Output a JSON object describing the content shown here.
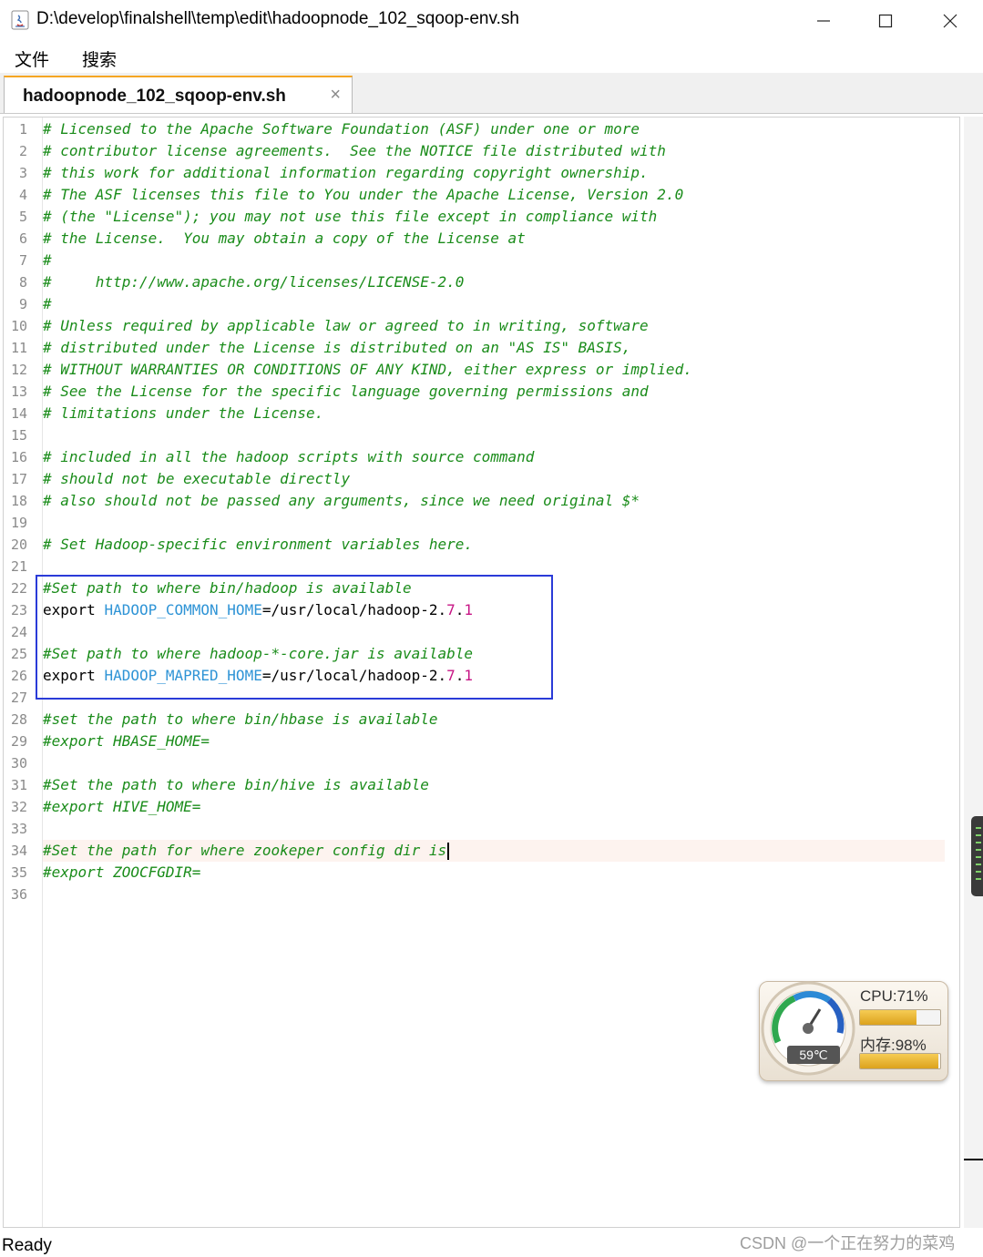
{
  "window": {
    "title": "D:\\develop\\finalshell\\temp\\edit\\hadoopnode_102_sqoop-env.sh"
  },
  "menu": {
    "items": [
      {
        "label": "文件"
      },
      {
        "label": "搜索"
      }
    ]
  },
  "tab": {
    "label": "hadoopnode_102_sqoop-env.sh",
    "close": "×"
  },
  "editor": {
    "current_line": 34,
    "lines": [
      {
        "n": "1",
        "tokens": [
          {
            "t": "cmt",
            "s": "# Licensed to the Apache Software Foundation (ASF) under one or more"
          }
        ]
      },
      {
        "n": "2",
        "tokens": [
          {
            "t": "cmt",
            "s": "# contributor license agreements.  See the NOTICE file distributed with"
          }
        ]
      },
      {
        "n": "3",
        "tokens": [
          {
            "t": "cmt",
            "s": "# this work for additional information regarding copyright ownership."
          }
        ]
      },
      {
        "n": "4",
        "tokens": [
          {
            "t": "cmt",
            "s": "# The ASF licenses this file to You under the Apache License, Version 2.0"
          }
        ]
      },
      {
        "n": "5",
        "tokens": [
          {
            "t": "cmt",
            "s": "# (the \"License\"); you may not use this file except in compliance with"
          }
        ]
      },
      {
        "n": "6",
        "tokens": [
          {
            "t": "cmt",
            "s": "# the License.  You may obtain a copy of the License at"
          }
        ]
      },
      {
        "n": "7",
        "tokens": [
          {
            "t": "cmt",
            "s": "#"
          }
        ]
      },
      {
        "n": "8",
        "tokens": [
          {
            "t": "cmt",
            "s": "#     http://www.apache.org/licenses/LICENSE-2.0"
          }
        ]
      },
      {
        "n": "9",
        "tokens": [
          {
            "t": "cmt",
            "s": "#"
          }
        ]
      },
      {
        "n": "10",
        "tokens": [
          {
            "t": "cmt",
            "s": "# Unless required by applicable law or agreed to in writing, software"
          }
        ]
      },
      {
        "n": "11",
        "tokens": [
          {
            "t": "cmt",
            "s": "# distributed under the License is distributed on an \"AS IS\" BASIS,"
          }
        ]
      },
      {
        "n": "12",
        "tokens": [
          {
            "t": "cmt",
            "s": "# WITHOUT WARRANTIES OR CONDITIONS OF ANY KIND, either express or implied."
          }
        ]
      },
      {
        "n": "13",
        "tokens": [
          {
            "t": "cmt",
            "s": "# See the License for the specific language governing permissions and"
          }
        ]
      },
      {
        "n": "14",
        "tokens": [
          {
            "t": "cmt",
            "s": "# limitations under the License."
          }
        ]
      },
      {
        "n": "15",
        "tokens": []
      },
      {
        "n": "16",
        "tokens": [
          {
            "t": "cmt",
            "s": "# included in all the hadoop scripts with source command"
          }
        ]
      },
      {
        "n": "17",
        "tokens": [
          {
            "t": "cmt",
            "s": "# should not be executable directly"
          }
        ]
      },
      {
        "n": "18",
        "tokens": [
          {
            "t": "cmt",
            "s": "# also should not be passed any arguments, since we need original $*"
          }
        ]
      },
      {
        "n": "19",
        "tokens": []
      },
      {
        "n": "20",
        "tokens": [
          {
            "t": "cmt",
            "s": "# Set Hadoop-specific environment variables here."
          }
        ]
      },
      {
        "n": "21",
        "tokens": []
      },
      {
        "n": "22",
        "tokens": [
          {
            "t": "cmt",
            "s": "#Set path to where bin/hadoop is available"
          }
        ]
      },
      {
        "n": "23",
        "tokens": [
          {
            "t": "kw",
            "s": "export "
          },
          {
            "t": "var",
            "s": "HADOOP_COMMON_HOME"
          },
          {
            "t": "plain",
            "s": "=/usr/local/hadoop-2."
          },
          {
            "t": "num",
            "s": "7"
          },
          {
            "t": "plain",
            "s": "."
          },
          {
            "t": "num",
            "s": "1"
          }
        ]
      },
      {
        "n": "24",
        "tokens": []
      },
      {
        "n": "25",
        "tokens": [
          {
            "t": "cmt",
            "s": "#Set path to where hadoop-*-core.jar is available"
          }
        ]
      },
      {
        "n": "26",
        "tokens": [
          {
            "t": "kw",
            "s": "export "
          },
          {
            "t": "var",
            "s": "HADOOP_MAPRED_HOME"
          },
          {
            "t": "plain",
            "s": "=/usr/local/hadoop-2."
          },
          {
            "t": "num",
            "s": "7"
          },
          {
            "t": "plain",
            "s": "."
          },
          {
            "t": "num",
            "s": "1"
          }
        ]
      },
      {
        "n": "27",
        "tokens": []
      },
      {
        "n": "28",
        "tokens": [
          {
            "t": "cmt",
            "s": "#set the path to where bin/hbase is available"
          }
        ]
      },
      {
        "n": "29",
        "tokens": [
          {
            "t": "cmt",
            "s": "#export HBASE_HOME="
          }
        ]
      },
      {
        "n": "30",
        "tokens": []
      },
      {
        "n": "31",
        "tokens": [
          {
            "t": "cmt",
            "s": "#Set the path to where bin/hive is available"
          }
        ]
      },
      {
        "n": "32",
        "tokens": [
          {
            "t": "cmt",
            "s": "#export HIVE_HOME="
          }
        ]
      },
      {
        "n": "33",
        "tokens": []
      },
      {
        "n": "34",
        "tokens": [
          {
            "t": "cmt",
            "s": "#Set the path for where zookeper config dir is"
          }
        ]
      },
      {
        "n": "35",
        "tokens": [
          {
            "t": "cmt",
            "s": "#export ZOOCFGDIR="
          }
        ]
      },
      {
        "n": "36",
        "tokens": []
      }
    ]
  },
  "monitor": {
    "cpu_label": "CPU:71%",
    "cpu_percent": 71,
    "mem_label": "内存:98%",
    "mem_percent": 98,
    "temperature": "59℃"
  },
  "status": {
    "text": "Ready"
  },
  "watermark": "CSDN @一个正在努力的菜鸡",
  "colors": {
    "comment": "#1a8c1a",
    "variable": "#2f94d6",
    "number": "#c71585",
    "highlight_box": "#2a3bd8",
    "tab_accent": "#f5a623"
  }
}
